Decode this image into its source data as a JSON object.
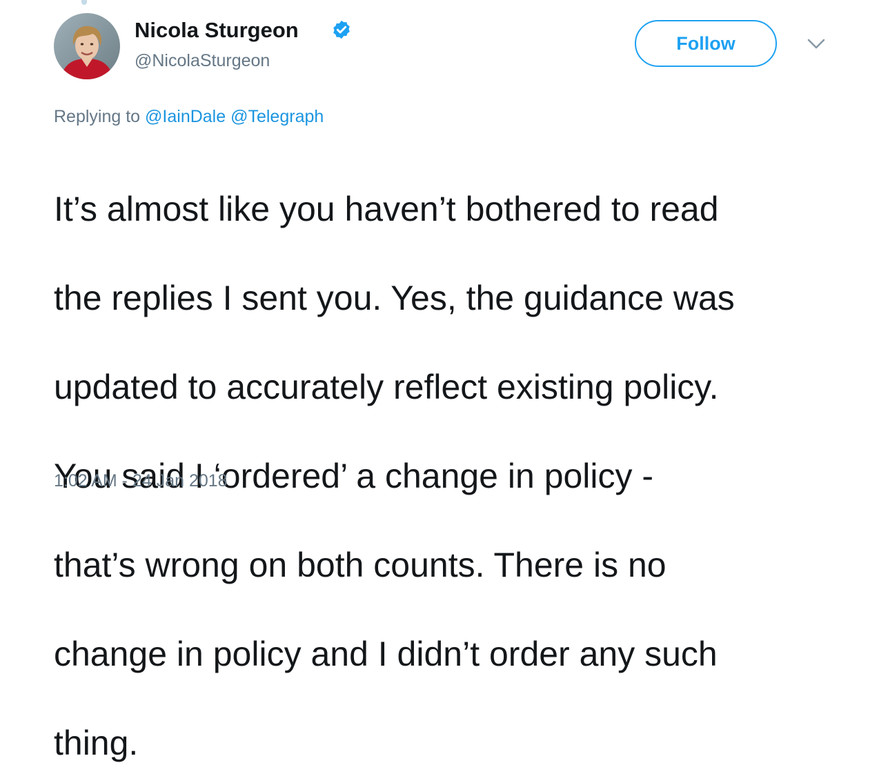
{
  "user": {
    "display_name": "Nicola Sturgeon",
    "handle": "@NicolaSturgeon",
    "verified_icon": "verified-badge-icon",
    "avatar_icon": "profile-photo"
  },
  "actions": {
    "follow_label": "Follow",
    "more_icon": "chevron-down-icon"
  },
  "reply": {
    "prefix": "Replying to",
    "mentions": [
      "@IainDale",
      "@Telegraph"
    ]
  },
  "tweet": {
    "text_lines": [
      "It’s almost like you haven’t bothered to read",
      "the replies I sent you. Yes, the guidance was",
      "updated to accurately reflect existing policy.",
      "You said I ‘ordered’ a change in policy -",
      "that’s wrong on both counts. There is no",
      "change in policy and I didn’t order any such",
      "thing."
    ],
    "timestamp": "1:02 AM - 24 Jan 2018"
  },
  "colors": {
    "accent": "#1da1f2",
    "link": "#1b95e0",
    "secondary_text": "#657786",
    "primary_text": "#14171a"
  }
}
